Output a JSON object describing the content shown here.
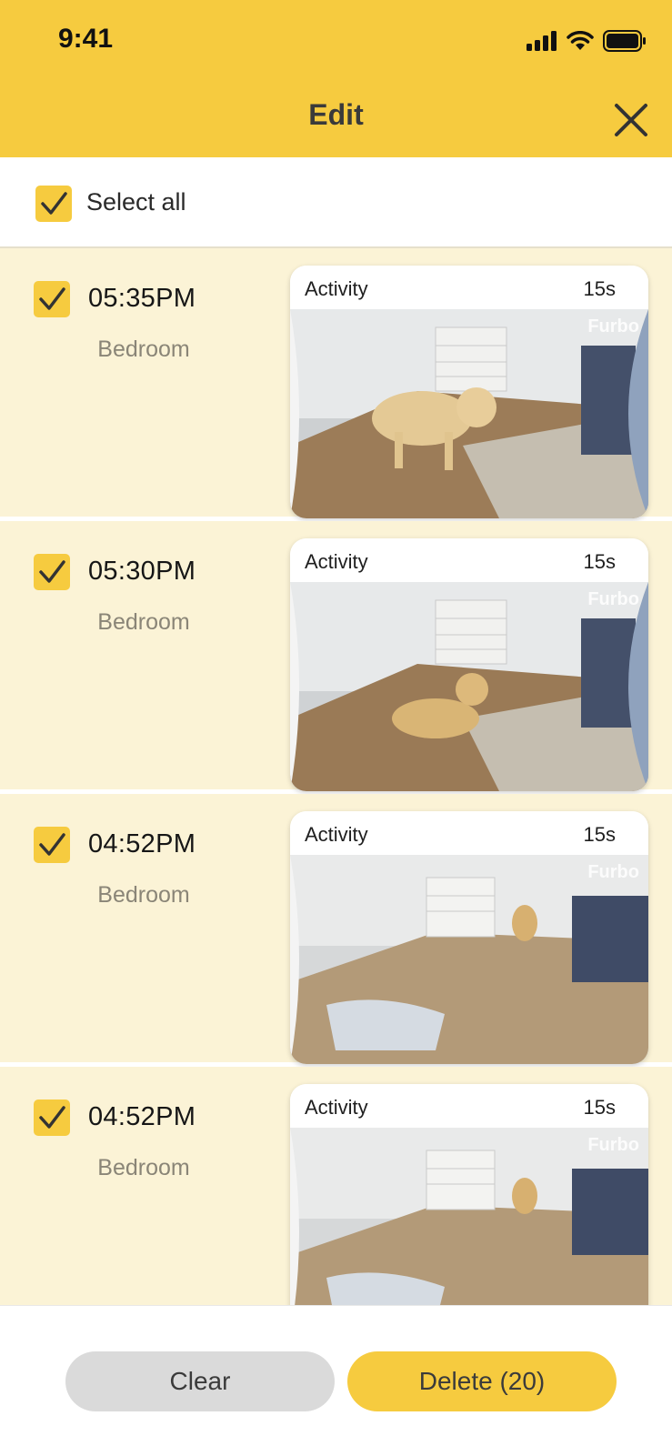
{
  "status_bar": {
    "time": "9:41"
  },
  "header": {
    "title": "Edit"
  },
  "select_all": {
    "label": "Select all",
    "checked": true
  },
  "items": [
    {
      "time": "05:35PM",
      "location": "Bedroom",
      "card_label": "Activity",
      "duration": "15s",
      "checked": true,
      "brand": "Furbo"
    },
    {
      "time": "05:30PM",
      "location": "Bedroom",
      "card_label": "Activity",
      "duration": "15s",
      "checked": true,
      "brand": "Furbo"
    },
    {
      "time": "04:52PM",
      "location": "Bedroom",
      "card_label": "Activity",
      "duration": "15s",
      "checked": true,
      "brand": "Furbo"
    },
    {
      "time": "04:52PM",
      "location": "Bedroom",
      "card_label": "Activity",
      "duration": "15s",
      "checked": true,
      "brand": "Furbo"
    }
  ],
  "footer": {
    "clear_label": "Clear",
    "delete_label": "Delete (20)"
  },
  "colors": {
    "accent": "#f6cb3f",
    "row_bg": "#fbf3d6",
    "clear_bg": "#dadada"
  },
  "icons": [
    "signal-icon",
    "wifi-icon",
    "battery-icon",
    "close-icon",
    "checkmark-icon",
    "video-thumbnail"
  ]
}
